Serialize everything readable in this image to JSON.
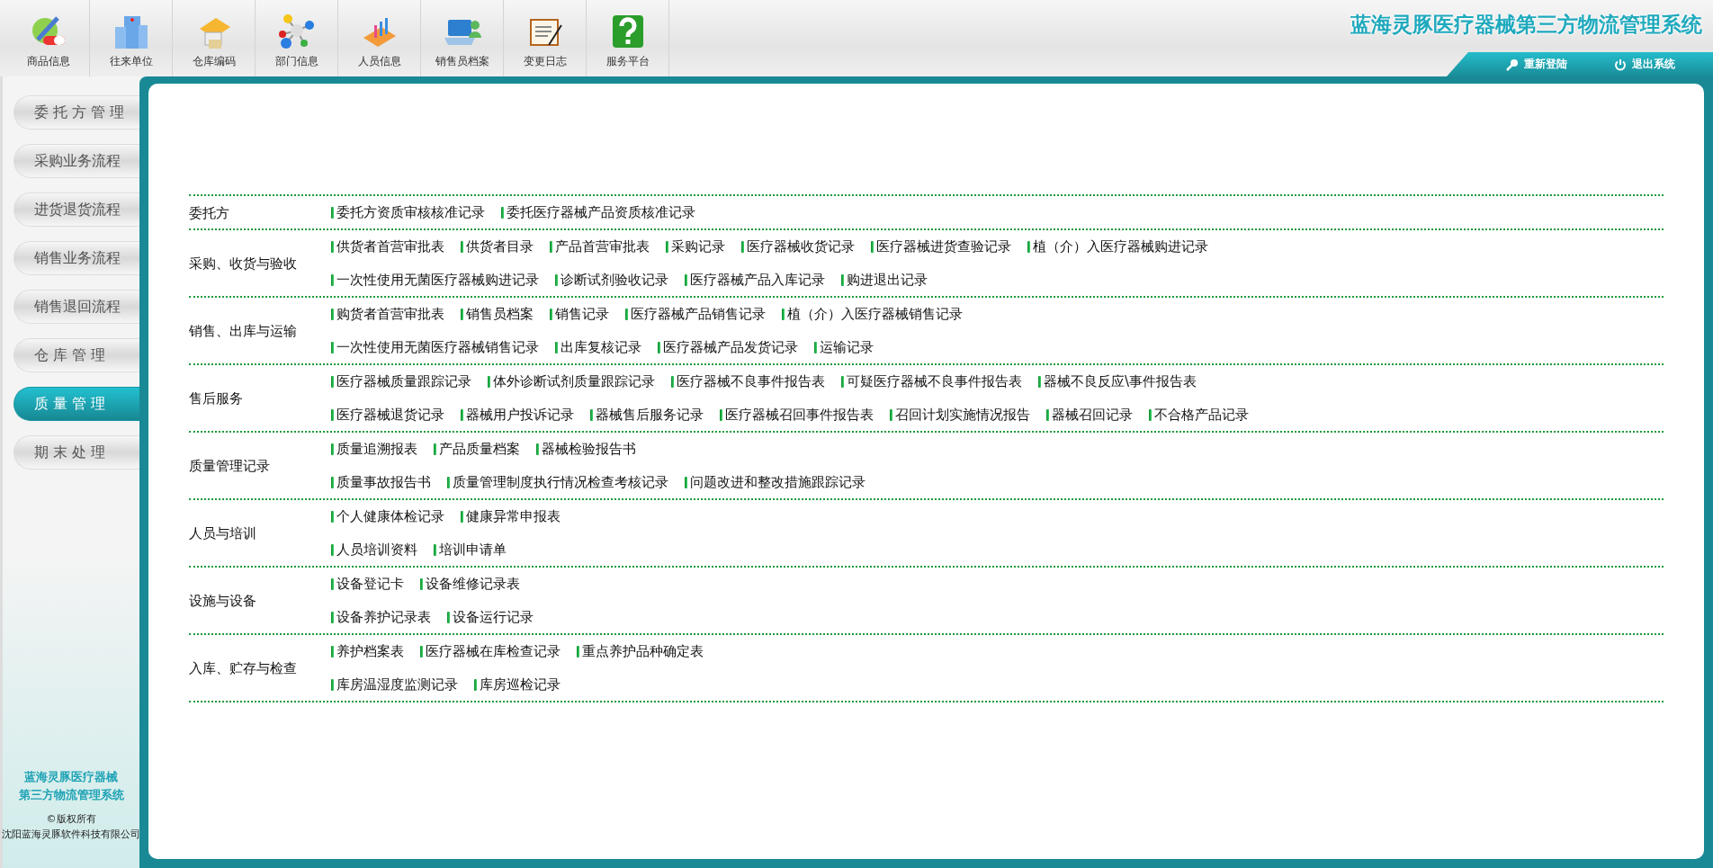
{
  "toolbar": [
    {
      "label": "商品信息"
    },
    {
      "label": "往来单位"
    },
    {
      "label": "仓库编码"
    },
    {
      "label": "部门信息"
    },
    {
      "label": "人员信息"
    },
    {
      "label": "销售员档案"
    },
    {
      "label": "变更日志"
    },
    {
      "label": "服务平台"
    }
  ],
  "app_title": "蓝海灵豚医疗器械第三方物流管理系统",
  "header_actions": [
    {
      "kind": "relogin",
      "label": "重新登陆"
    },
    {
      "kind": "logout",
      "label": "退出系统"
    }
  ],
  "sidebar": {
    "items": [
      {
        "label": "委 托 方 管 理",
        "selected": false
      },
      {
        "label": "采购业务流程",
        "selected": false
      },
      {
        "label": "进货退货流程",
        "selected": false
      },
      {
        "label": "销售业务流程",
        "selected": false
      },
      {
        "label": "销售退回流程",
        "selected": false
      },
      {
        "label": "仓 库 管 理",
        "selected": false
      },
      {
        "label": "质 量 管 理",
        "selected": true
      },
      {
        "label": "期 末 处 理",
        "selected": false
      }
    ],
    "footer": {
      "system_name_1": "蓝海灵豚医疗器械",
      "system_name_2": "第三方物流管理系统",
      "copyright": "©版权所有",
      "company": "沈阳蓝海灵豚软件科技有限公司"
    }
  },
  "categories": [
    {
      "label": "委托方",
      "lines": [
        [
          "委托方资质审核核准记录",
          "委托医疗器械产品资质核准记录"
        ]
      ]
    },
    {
      "label": "采购、收货与验收",
      "lines": [
        [
          "供货者首营审批表",
          "供货者目录",
          "产品首营审批表",
          "采购记录",
          "医疗器械收货记录",
          "医疗器械进货查验记录",
          "植（介）入医疗器械购进记录"
        ],
        [
          "一次性使用无菌医疗器械购进记录",
          "诊断试剂验收记录",
          "医疗器械产品入库记录",
          "购进退出记录"
        ]
      ]
    },
    {
      "label": "销售、出库与运输",
      "lines": [
        [
          "购货者首营审批表",
          "销售员档案",
          "销售记录",
          "医疗器械产品销售记录",
          "植（介）入医疗器械销售记录"
        ],
        [
          "一次性使用无菌医疗器械销售记录",
          "出库复核记录",
          "医疗器械产品发货记录",
          "运输记录"
        ]
      ]
    },
    {
      "label": "售后服务",
      "lines": [
        [
          "医疗器械质量跟踪记录",
          "体外诊断试剂质量跟踪记录",
          "医疗器械不良事件报告表",
          "可疑医疗器械不良事件报告表",
          "器械不良反应\\事件报告表"
        ],
        [
          "医疗器械退货记录",
          "器械用户投诉记录",
          "器械售后服务记录",
          "医疗器械召回事件报告表",
          "召回计划实施情况报告",
          "器械召回记录",
          "不合格产品记录"
        ]
      ]
    },
    {
      "label": "质量管理记录",
      "lines": [
        [
          "质量追溯报表",
          "产品质量档案",
          "器械检验报告书"
        ],
        [
          "质量事故报告书",
          "质量管理制度执行情况检查考核记录",
          "问题改进和整改措施跟踪记录"
        ]
      ]
    },
    {
      "label": "人员与培训",
      "lines": [
        [
          "个人健康体检记录",
          "健康异常申报表"
        ],
        [
          "人员培训资料",
          "培训申请单"
        ]
      ]
    },
    {
      "label": "设施与设备",
      "lines": [
        [
          "设备登记卡",
          "设备维修记录表"
        ],
        [
          "设备养护记录表",
          "设备运行记录"
        ]
      ]
    },
    {
      "label": "入库、贮存与检查",
      "lines": [
        [
          "养护档案表",
          "医疗器械在库检查记录",
          "重点养护品种确定表"
        ],
        [
          "库房温湿度监测记录",
          "库房巡检记录"
        ]
      ]
    }
  ]
}
